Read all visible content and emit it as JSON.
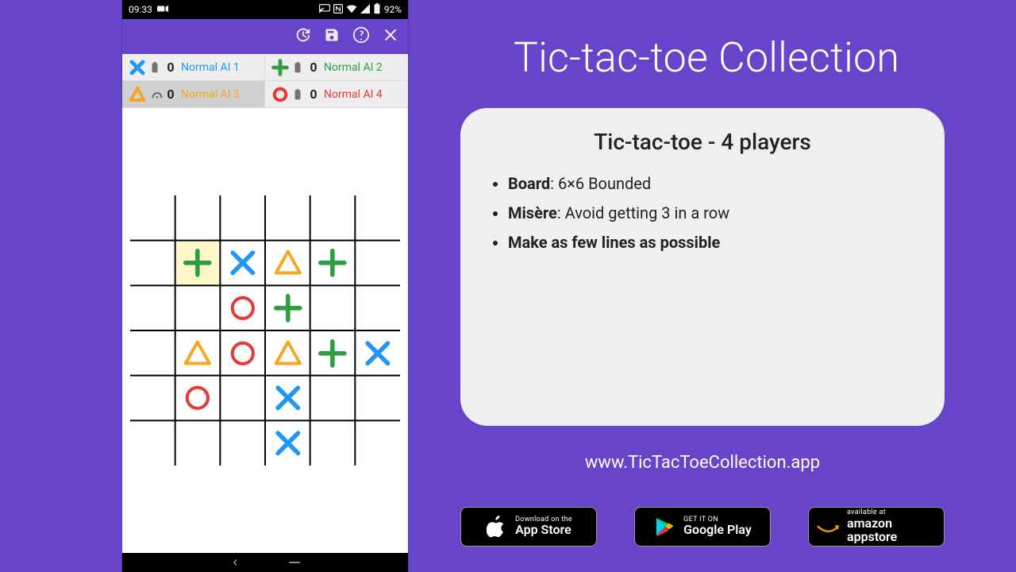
{
  "statusbar": {
    "time": "09:33",
    "battery": "92%"
  },
  "appbar": {
    "actions": [
      "history",
      "save",
      "help",
      "close"
    ]
  },
  "players": [
    {
      "symbol": "x",
      "color": "#2196f3",
      "score": "0",
      "name": "Normal AI 1",
      "name_color": "#2196f3",
      "active": false,
      "thinking": false
    },
    {
      "symbol": "plus",
      "color": "#2e9e3f",
      "score": "0",
      "name": "Normal AI 2",
      "name_color": "#2e9e3f",
      "active": false,
      "thinking": false
    },
    {
      "symbol": "tri",
      "color": "#f5a623",
      "score": "0",
      "name": "Normal AI 3",
      "name_color": "#f5a623",
      "active": true,
      "thinking": true
    },
    {
      "symbol": "o",
      "color": "#e53935",
      "score": "0",
      "name": "Normal AI 4",
      "name_color": "#e53935",
      "active": false,
      "thinking": false
    }
  ],
  "board": {
    "cols": 6,
    "rows": 6,
    "highlight": {
      "r": 1,
      "c": 1
    },
    "cells": [
      [
        "",
        "",
        "",
        "",
        "",
        ""
      ],
      [
        "",
        "plus",
        "x",
        "tri",
        "plus",
        ""
      ],
      [
        "",
        "",
        "o",
        "plus",
        "",
        ""
      ],
      [
        "",
        "tri",
        "o",
        "tri",
        "plus",
        "x"
      ],
      [
        "",
        "o",
        "",
        "x",
        "",
        ""
      ],
      [
        "",
        "",
        "",
        "x",
        "",
        ""
      ]
    ],
    "colors": {
      "x": "#2196f3",
      "plus": "#2e9e3f",
      "tri": "#f5a623",
      "o": "#e53935"
    }
  },
  "title": "Tic-tac-toe Collection",
  "card": {
    "heading": "Tic-tac-toe - 4 players",
    "bullets": [
      {
        "bold": "Board",
        "rest": ":  6×6 Bounded"
      },
      {
        "bold": "Misère",
        "rest": ":  Avoid getting 3 in a row"
      },
      {
        "bold": "Make as few lines as possible",
        "rest": ""
      }
    ]
  },
  "url": "www.TicTacToeCollection.app",
  "stores": {
    "apple": {
      "small": "Download on the",
      "big": "App Store"
    },
    "google": {
      "small": "GET IT ON",
      "big": "Google Play"
    },
    "amazon": {
      "small": "available at",
      "big": "amazon appstore"
    }
  }
}
